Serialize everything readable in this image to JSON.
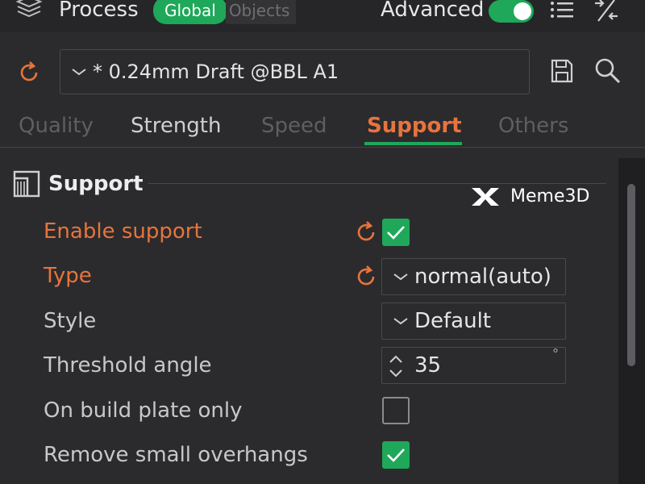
{
  "header": {
    "title": "Process",
    "mode_global": "Global",
    "mode_objects": "Objects",
    "advanced_label": "Advanced",
    "advanced_on": true,
    "icons": [
      "layers-icon",
      "list-icon",
      "compare-icon"
    ]
  },
  "preset": {
    "value": "* 0.24mm Draft @BBL A1",
    "icons": [
      "reset-icon",
      "chevron-down-icon",
      "save-icon",
      "search-icon"
    ]
  },
  "tabs": [
    {
      "label": "Quality",
      "active": false
    },
    {
      "label": "Strength",
      "active": false
    },
    {
      "label": "Speed",
      "active": false
    },
    {
      "label": "Support",
      "active": true
    },
    {
      "label": "Others",
      "active": false
    }
  ],
  "section": {
    "title": "Support",
    "icon": "support-section-icon"
  },
  "watermark": {
    "text": "Meme3D"
  },
  "settings": {
    "enable_support": {
      "label": "Enable support",
      "checked": true,
      "modified": true
    },
    "type": {
      "label": "Type",
      "value": "normal(auto)",
      "modified": true
    },
    "style": {
      "label": "Style",
      "value": "Default"
    },
    "threshold_angle": {
      "label": "Threshold angle",
      "value": "35",
      "unit": "°"
    },
    "build_plate_only": {
      "label": "On build plate only",
      "checked": false
    },
    "remove_small_overhangs": {
      "label": "Remove small overhangs",
      "checked": true
    }
  },
  "colors": {
    "accent_green": "#1fa85a",
    "modified_orange": "#e8743b",
    "background": "#2b2b2e"
  }
}
